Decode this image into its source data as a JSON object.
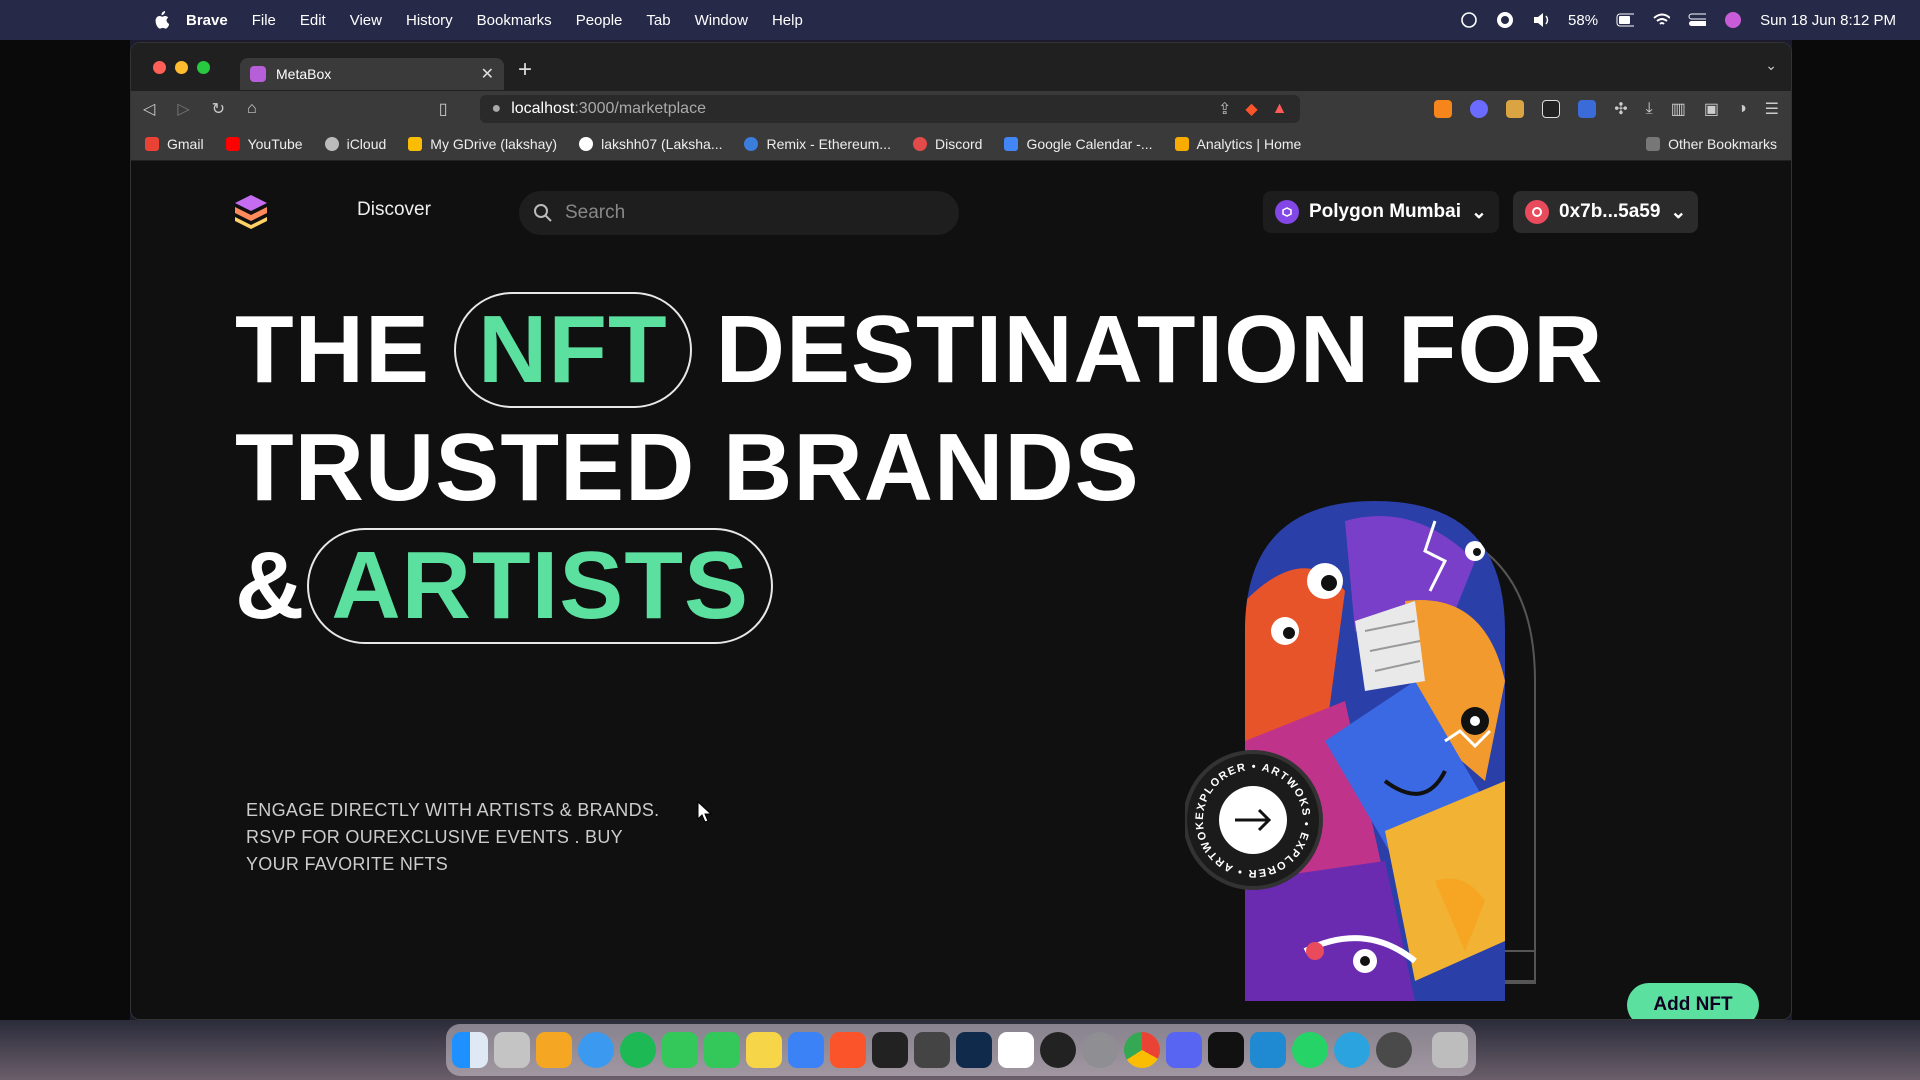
{
  "menubar": {
    "app": "Brave",
    "items": [
      "File",
      "Edit",
      "View",
      "History",
      "Bookmarks",
      "People",
      "Tab",
      "Window",
      "Help"
    ],
    "battery": "58%",
    "datetime": "Sun 18 Jun  8:12 PM"
  },
  "browser": {
    "tab_title": "MetaBox",
    "url_host": "localhost",
    "url_path": ":3000/marketplace",
    "bookmarks": [
      {
        "label": "Gmail",
        "color": "#ea4335"
      },
      {
        "label": "YouTube",
        "color": "#ff0000"
      },
      {
        "label": "iCloud",
        "color": "#bbbbbb"
      },
      {
        "label": "My GDrive (lakshay)",
        "color": "#fbbc04"
      },
      {
        "label": "lakshh07 (Laksha...",
        "color": "#ffffff"
      },
      {
        "label": "Remix - Ethereum...",
        "color": "#3b7ddd"
      },
      {
        "label": "Discord",
        "color": "#e34b4b"
      },
      {
        "label": "Google Calendar -...",
        "color": "#4285f4"
      },
      {
        "label": "Analytics | Home",
        "color": "#f9ab00"
      }
    ],
    "other_bookmarks": "Other Bookmarks"
  },
  "page": {
    "nav_discover": "Discover",
    "search_placeholder": "Search",
    "network": "Polygon Mumbai",
    "wallet": "0x7b...5a59",
    "hero": {
      "line1_pre": "THE",
      "line1_pill": "NFT",
      "line1_post": "DESTINATION FOR",
      "line2": "TRUSTED BRANDS",
      "line3_pre": "&",
      "line3_pill": "ARTISTS"
    },
    "subtitle": "ENGAGE DIRECTLY WITH ARTISTS & BRANDS. RSVP FOR OUREXCLUSIVE EVENTS . BUY YOUR FAVORITE NFTS",
    "badge_text": "EXPLORER • ARTWOKS • EXPLORER • ARTWOKS •",
    "add_nft": "Add NFT"
  },
  "colors": {
    "accent": "#5ce0a0",
    "menubar": "#262a48",
    "polygon": "#8247e5"
  }
}
